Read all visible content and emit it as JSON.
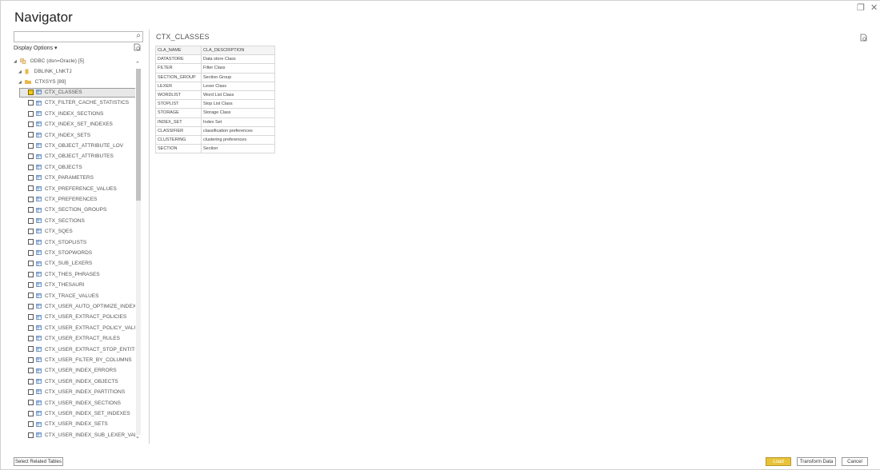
{
  "window": {
    "title": "Navigator",
    "restore_icon": "restore-icon",
    "close_icon": "close-icon"
  },
  "search": {
    "value": "",
    "placeholder": ""
  },
  "display_options": "Display Options ▾",
  "tree": {
    "root": "ODBC (dsn=Oracle) [5]",
    "dblink": "DBLINK_LNKTJ",
    "ctxsys": "CTXSYS [89]",
    "items": [
      "CTX_CLASSES",
      "CTX_FILTER_CACHE_STATISTICS",
      "CTX_INDEX_SECTIONS",
      "CTX_INDEX_SET_INDEXES",
      "CTX_INDEX_SETS",
      "CTX_OBJECT_ATTRIBUTE_LOV",
      "CTX_OBJECT_ATTRIBUTES",
      "CTX_OBJECTS",
      "CTX_PARAMETERS",
      "CTX_PREFERENCE_VALUES",
      "CTX_PREFERENCES",
      "CTX_SECTION_GROUPS",
      "CTX_SECTIONS",
      "CTX_SQES",
      "CTX_STOPLISTS",
      "CTX_STOPWORDS",
      "CTX_SUB_LEXERS",
      "CTX_THES_PHRASES",
      "CTX_THESAURI",
      "CTX_TRACE_VALUES",
      "CTX_USER_AUTO_OPTIMIZE_INDEXES",
      "CTX_USER_EXTRACT_POLICIES",
      "CTX_USER_EXTRACT_POLICY_VALUES",
      "CTX_USER_EXTRACT_RULES",
      "CTX_USER_EXTRACT_STOP_ENTITIES",
      "CTX_USER_FILTER_BY_COLUMNS",
      "CTX_USER_INDEX_ERRORS",
      "CTX_USER_INDEX_OBJECTS",
      "CTX_USER_INDEX_PARTITIONS",
      "CTX_USER_INDEX_SECTIONS",
      "CTX_USER_INDEX_SET_INDEXES",
      "CTX_USER_INDEX_SETS",
      "CTX_USER_INDEX_SUB_LEXER_VALS"
    ],
    "selected_index": 0
  },
  "preview": {
    "title": "CTX_CLASSES",
    "columns": [
      "CLA_NAME",
      "CLA_DESCRIPTION"
    ],
    "rows": [
      [
        "DATASTORE",
        "Data store Class"
      ],
      [
        "FILTER",
        "Filter Class"
      ],
      [
        "SECTION_GROUP",
        "Section Group"
      ],
      [
        "LEXER",
        "Lexer Class"
      ],
      [
        "WORDLIST",
        "Word List Class"
      ],
      [
        "STOPLIST",
        "Stop List Class"
      ],
      [
        "STORAGE",
        "Storage Class"
      ],
      [
        "INDEX_SET",
        "Index Set"
      ],
      [
        "CLASSIFIER",
        "classification preferences"
      ],
      [
        "CLUSTERING",
        "clustering preferences"
      ],
      [
        "SECTION",
        "Section"
      ]
    ]
  },
  "buttons": {
    "select_related": "Select Related Tables",
    "load": "Load",
    "transform": "Transform Data",
    "cancel": "Cancel"
  },
  "colors": {
    "accent": "#f2c811",
    "load_button": "#e8c33a",
    "folder": "#e8b84a"
  }
}
